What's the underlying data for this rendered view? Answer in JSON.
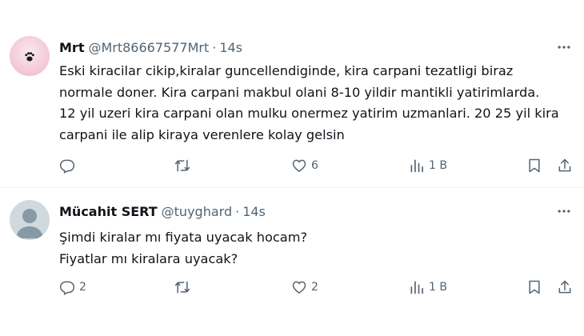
{
  "tweets": [
    {
      "author": "Mrt",
      "handle": "@Mrt86667577Mrt",
      "separator": "·",
      "time": "14s",
      "lines": [
        "Eski kiracilar cikip,kiralar guncellendiginde, kira carpani tezatligi biraz",
        "normale doner. Kira carpani makbul olani 8-10 yildir mantikli yatirimlarda.",
        "12 yil uzeri kira carpani olan mulku  onermez yatirim uzmanlari. 20 25 yil kira",
        "carpani ile alip kiraya verenlere kolay gelsin"
      ],
      "replies": "",
      "retweets": "",
      "likes": "6",
      "views": "1 B"
    },
    {
      "author": "Mücahit SERT",
      "handle": "@tuyghard",
      "separator": "·",
      "time": "14s",
      "lines": [
        "Şimdi kiralar mı fiyata uyacak hocam?",
        "Fiyatlar mı kiralara uyacak?"
      ],
      "replies": "2",
      "retweets": "",
      "likes": "2",
      "views": "1 B"
    }
  ],
  "icons": {
    "reply": "reply-icon",
    "retweet": "retweet-icon",
    "like": "heart-icon",
    "views": "views-icon",
    "bookmark": "bookmark-icon",
    "share": "share-icon",
    "more": "more-icon"
  },
  "colors": {
    "text": "#0f1419",
    "secondary": "#536471",
    "divider": "#eff3f4",
    "avatar_default": "#cfd9de"
  }
}
